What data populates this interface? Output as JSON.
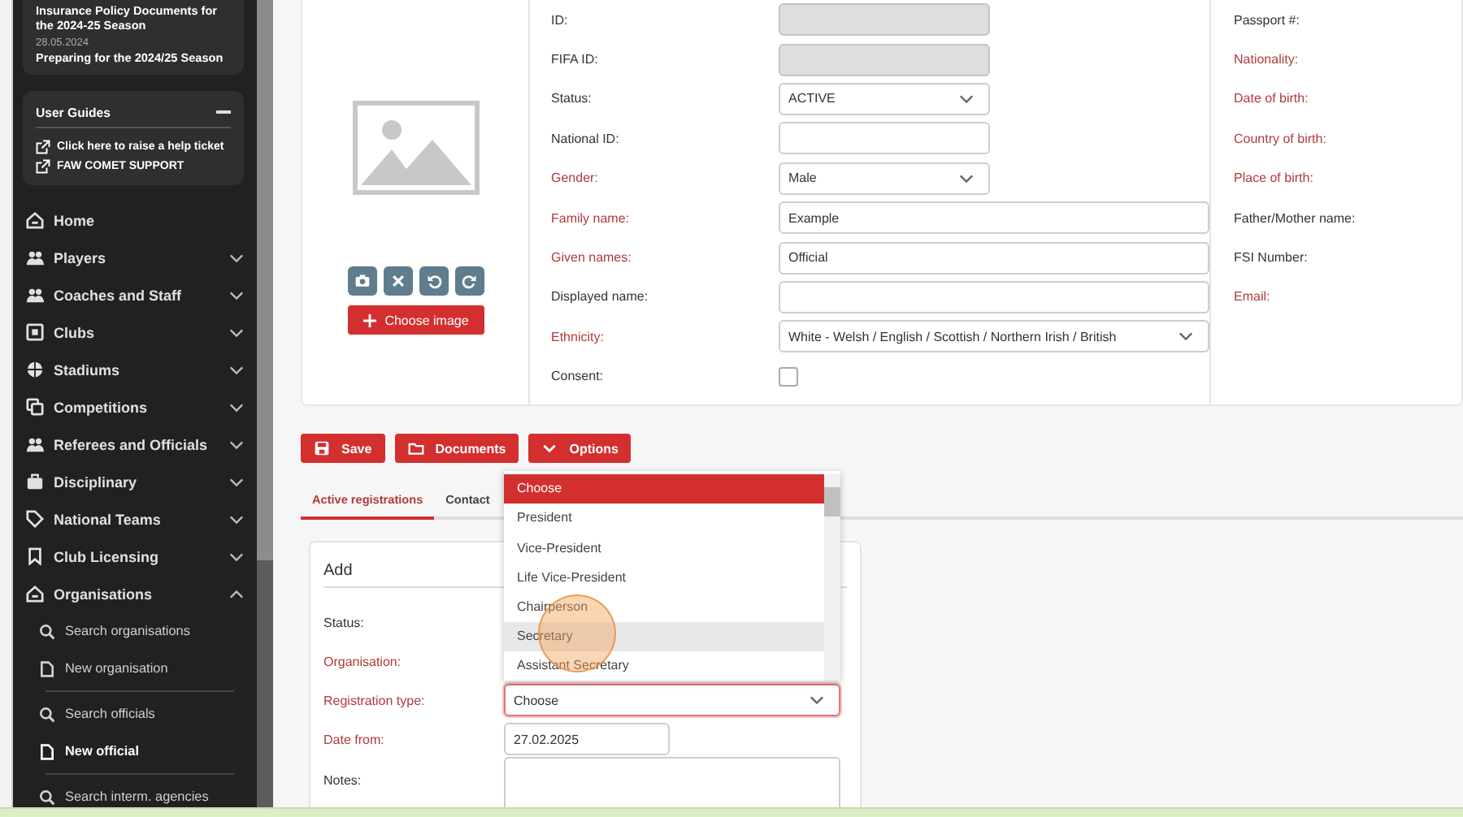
{
  "sidebar": {
    "news": {
      "title": "Insurance Policy Documents for the 2024-25 Season",
      "date": "28.05.2024",
      "headline": "Preparing for the 2024/25 Season"
    },
    "user_guides": {
      "title": "User Guides",
      "expanded": true,
      "links": [
        "Click here to raise a help ticket",
        "FAW COMET SUPPORT"
      ]
    },
    "nav": [
      {
        "label": "Home"
      },
      {
        "label": "Players",
        "expanded": false
      },
      {
        "label": "Coaches and Staff",
        "expanded": false
      },
      {
        "label": "Clubs",
        "expanded": false
      },
      {
        "label": "Stadiums",
        "expanded": false
      },
      {
        "label": "Competitions",
        "expanded": false
      },
      {
        "label": "Referees and Officials",
        "expanded": false
      },
      {
        "label": "Disciplinary",
        "expanded": false
      },
      {
        "label": "National Teams",
        "expanded": false
      },
      {
        "label": "Club Licensing",
        "expanded": false
      },
      {
        "label": "Organisations",
        "expanded": true,
        "children": [
          {
            "items": [
              {
                "label": "Search organisations",
                "kind": "search",
                "selected": false
              },
              {
                "label": "New organisation",
                "kind": "new",
                "selected": false
              }
            ]
          },
          {
            "items": [
              {
                "label": "Search officials",
                "kind": "search",
                "selected": false
              },
              {
                "label": "New official",
                "kind": "new",
                "selected": true
              }
            ]
          },
          {
            "items": [
              {
                "label": "Search interm. agencies",
                "kind": "search",
                "selected": false
              }
            ]
          }
        ]
      }
    ]
  },
  "profile": {
    "choose_image": "Choose image",
    "fields": [
      {
        "label": "ID:",
        "required": false,
        "kind": "text",
        "disabled": true
      },
      {
        "label": "FIFA ID:",
        "required": false,
        "kind": "text",
        "disabled": true
      },
      {
        "label": "Status:",
        "required": false,
        "kind": "select",
        "value": "ACTIVE"
      },
      {
        "label": "National ID:",
        "required": false,
        "kind": "text",
        "disabled": false
      },
      {
        "label": "Gender:",
        "required": true,
        "kind": "select",
        "value": "Male"
      },
      {
        "label": "Family name:",
        "required": true,
        "kind": "text",
        "disabled": false,
        "value": "Example"
      },
      {
        "label": "Given names:",
        "required": true,
        "kind": "text",
        "disabled": false,
        "value": "Official"
      },
      {
        "label": "Displayed name:",
        "required": false,
        "kind": "text",
        "disabled": false
      },
      {
        "label": "Ethnicity:",
        "required": true,
        "kind": "select",
        "value": "White - Welsh / English / Scottish / Northern Irish / British"
      },
      {
        "label": "Consent:",
        "required": false,
        "kind": "checkbox",
        "checked": false
      }
    ],
    "details": [
      {
        "label": "Passport #:",
        "required": false
      },
      {
        "label": "Nationality:",
        "required": true
      },
      {
        "label": "Date of birth:",
        "required": true
      },
      {
        "label": "Country of birth:",
        "required": true
      },
      {
        "label": "Place of birth:",
        "required": true
      },
      {
        "label": "Father/Mother name:",
        "required": false
      },
      {
        "label": "FSI Number:",
        "required": false
      },
      {
        "label": "Email:",
        "required": true
      }
    ]
  },
  "actions": [
    {
      "label": "Save"
    },
    {
      "label": "Documents"
    },
    {
      "label": "Options"
    }
  ],
  "tabs": [
    {
      "label": "Active registrations",
      "selected": true
    },
    {
      "label": "Contact",
      "selected": false
    }
  ],
  "add_panel": {
    "title": "Add",
    "rows": [
      {
        "label": "Status:",
        "required": false
      },
      {
        "label": "Organisation:",
        "required": true
      },
      {
        "label": "Registration type:",
        "required": true,
        "kind": "select",
        "value": "Choose",
        "focused": true
      },
      {
        "label": "Date from:",
        "required": true,
        "kind": "text",
        "value": "27.02.2025"
      },
      {
        "label": "Notes:",
        "required": false,
        "kind": "textarea"
      }
    ],
    "dropdown": {
      "options": [
        {
          "label": "Choose",
          "selected": true,
          "hovered": false
        },
        {
          "label": "President",
          "selected": false,
          "hovered": false
        },
        {
          "label": "Vice-President",
          "selected": false,
          "hovered": false
        },
        {
          "label": "Life Vice-President",
          "selected": false,
          "hovered": false
        },
        {
          "label": "Chairperson",
          "selected": false,
          "hovered": false
        },
        {
          "label": "Secretary",
          "selected": false,
          "hovered": true
        },
        {
          "label": "Assistant Secretary",
          "selected": false,
          "hovered": false
        }
      ]
    }
  }
}
